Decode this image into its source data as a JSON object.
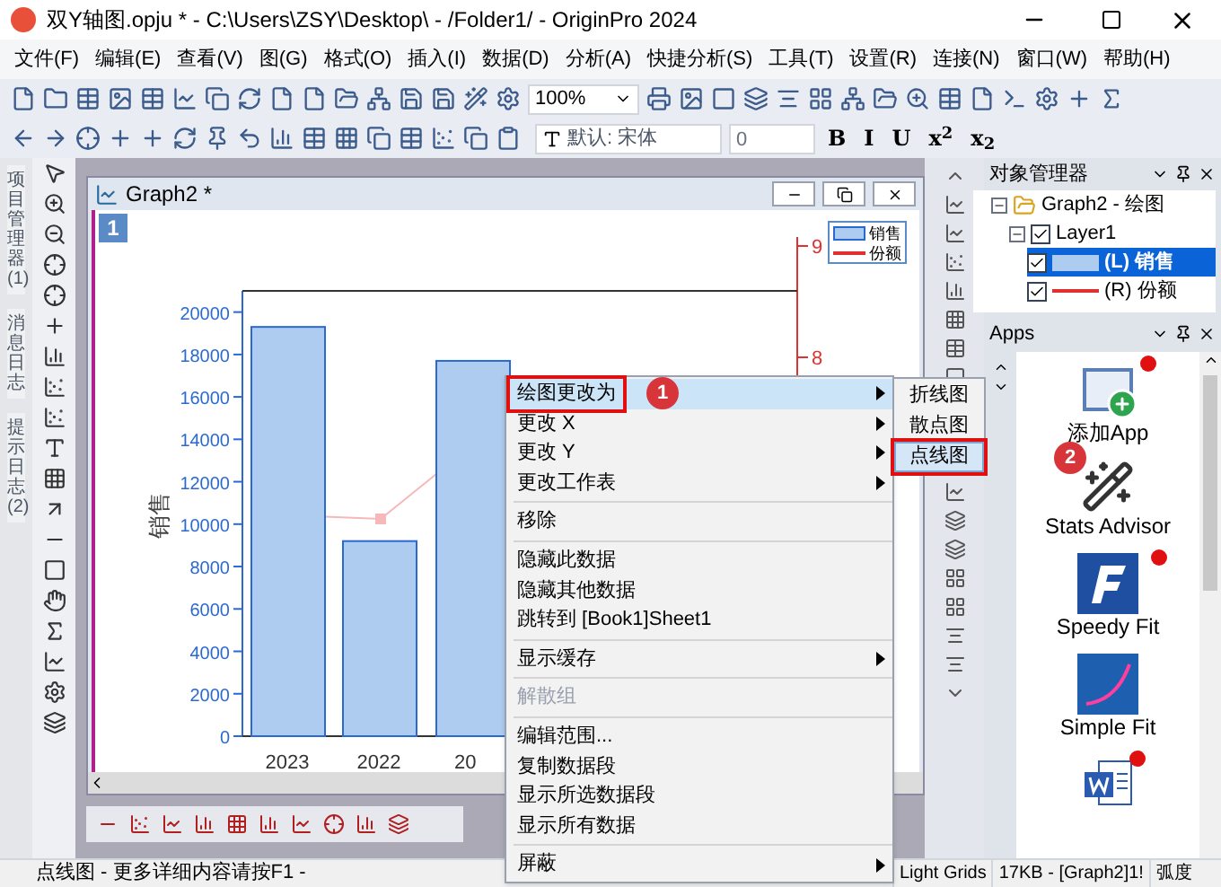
{
  "window": {
    "title": "双Y轴图.opju * - C:\\Users\\ZSY\\Desktop\\ - /Folder1/ - OriginPro 2024"
  },
  "menu": [
    "文件(F)",
    "编辑(E)",
    "查看(V)",
    "图(G)",
    "格式(O)",
    "插入(I)",
    "数据(D)",
    "分析(A)",
    "快捷分析(S)",
    "工具(T)",
    "设置(R)",
    "连接(N)",
    "窗口(W)",
    "帮助(H)"
  ],
  "toolbar": {
    "zoom": "100%",
    "font": "默认: 宋体",
    "font_size": "0",
    "format_buttons": [
      "B",
      "I",
      "U",
      "x$^{2}$",
      "x$_{2}$"
    ]
  },
  "side_tabs": [
    "项目管理器 (1)",
    "消息日志",
    "提示日志 (2)"
  ],
  "graph": {
    "title": "Graph2 *",
    "layer": "1",
    "right_ticks": [
      "9",
      "8"
    ],
    "legend": [
      {
        "kind": "bar"
      },
      {
        "label": "份额",
        "kind": "line"
      }
    ],
    "chart_data": {
      "type": "bar",
      "ylabel": "销售",
      "categories": [
        "2023",
        "2022",
        "20"
      ],
      "series": [
        {
          "name": "销售",
          "color": "#aecbf0",
          "values": [
            19300,
            9200,
            17700
          ]
        }
      ],
      "ylim": [
        0,
        21000
      ],
      "yticks": [
        0,
        2000,
        4000,
        6000,
        8000,
        10000,
        12000,
        14000,
        16000,
        18000,
        20000
      ]
    }
  },
  "context_menu": [
    {
      "kind": "item",
      "label": "绘图更改为",
      "submenu": true,
      "selected": true,
      "disabled": false,
      "callout": "1"
    },
    {
      "kind": "item",
      "label": "更改 X",
      "submenu": true,
      "selected": false,
      "disabled": false
    },
    {
      "kind": "item",
      "label": "更改 Y",
      "submenu": true,
      "selected": false,
      "disabled": false
    },
    {
      "kind": "item",
      "label": "更改工作表",
      "submenu": true,
      "selected": false,
      "disabled": false
    },
    {
      "kind": "separator"
    },
    {
      "kind": "item",
      "label": "移除",
      "submenu": false,
      "selected": false,
      "disabled": false
    },
    {
      "kind": "separator"
    },
    {
      "kind": "item",
      "label": "隐藏此数据",
      "submenu": false,
      "selected": false,
      "disabled": false
    },
    {
      "kind": "item",
      "label": "隐藏其他数据",
      "submenu": false,
      "selected": false,
      "disabled": false
    },
    {
      "kind": "item",
      "label": "跳转到 [Book1]Sheet1",
      "submenu": false,
      "selected": false,
      "disabled": false
    },
    {
      "kind": "separator"
    },
    {
      "kind": "item",
      "label": "显示缓存",
      "submenu": true,
      "selected": false,
      "disabled": false
    },
    {
      "kind": "separator"
    },
    {
      "kind": "item",
      "label": "解散组",
      "submenu": false,
      "selected": false,
      "disabled": true
    },
    {
      "kind": "separator"
    },
    {
      "kind": "item",
      "label": "编辑范围...",
      "submenu": false,
      "selected": false,
      "disabled": false
    },
    {
      "kind": "item",
      "label": "复制数据段",
      "submenu": false,
      "selected": false,
      "disabled": false
    },
    {
      "kind": "item",
      "label": "显示所选数据段",
      "submenu": false,
      "selected": false,
      "disabled": false
    },
    {
      "kind": "item",
      "label": "显示所有数据",
      "submenu": false,
      "selected": false,
      "disabled": false
    },
    {
      "kind": "separator"
    },
    {
      "kind": "item",
      "label": "屏蔽",
      "submenu": true,
      "selected": false,
      "disabled": false
    }
  ],
  "submenu": [
    {
      "label": "折线图",
      "selected": false
    },
    {
      "label": "散点图",
      "selected": false
    },
    {
      "label": "点线图",
      "selected": true,
      "callout": "2"
    }
  ],
  "object_manager": {
    "title": "对象管理器",
    "tree": [
      {
        "label": "Graph2 - 绘图",
        "expanded": true,
        "children": [
          {
            "label": "Layer1",
            "checked": true,
            "expanded": true,
            "children": [
              {
                "label": "(L) 销售",
                "checked": true,
                "selected": true,
                "kind": "bar"
              },
              {
                "label": "(R) 份额",
                "checked": true,
                "selected": false,
                "kind": "line"
              }
            ]
          }
        ]
      }
    ]
  },
  "apps": {
    "title": "Apps",
    "items": [
      {
        "kind": "add",
        "label": "添加App",
        "new": true
      },
      {
        "kind": "advisor",
        "label": "Stats Advisor",
        "new": false
      },
      {
        "kind": "speedy",
        "label": "Speedy Fit",
        "new": true
      },
      {
        "kind": "simple",
        "label": "Simple Fit",
        "new": false
      },
      {
        "kind": "word",
        "new": true
      }
    ]
  },
  "status_bar": {
    "hint": "点线图 - 更多详细内容请按F1 -",
    "items": [
      "Light Grids",
      "17KB - [Graph2]1!",
      "弧度"
    ]
  }
}
